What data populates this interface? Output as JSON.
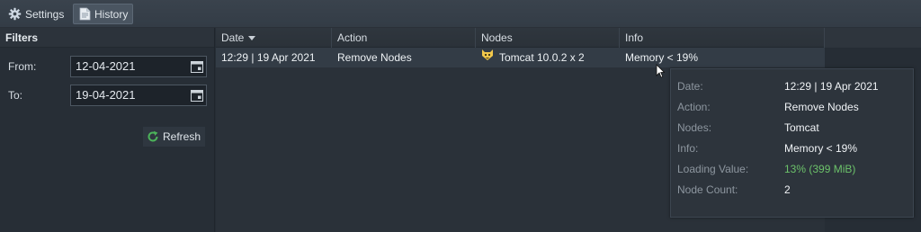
{
  "tabs": {
    "settings_label": "Settings",
    "history_label": "History"
  },
  "filters": {
    "title": "Filters",
    "from_label": "From:",
    "from_value": "12-04-2021",
    "to_label": "To:",
    "to_value": "19-04-2021",
    "refresh_label": "Refresh"
  },
  "table": {
    "columns": [
      "Date",
      "Action",
      "Nodes",
      "Info"
    ],
    "rows": [
      {
        "date": "12:29 | 19 Apr 2021",
        "action": "Remove Nodes",
        "nodes": "Tomcat 10.0.2 x 2",
        "info": "Memory < 19%"
      }
    ]
  },
  "tooltip": {
    "items": [
      {
        "key": "Date:",
        "value": "12:29 | 19 Apr 2021"
      },
      {
        "key": "Action:",
        "value": "Remove Nodes"
      },
      {
        "key": "Nodes:",
        "value": "Tomcat"
      },
      {
        "key": "Info:",
        "value": "Memory < 19%"
      },
      {
        "key": "Loading Value:",
        "value": "13% (399 MiB)"
      },
      {
        "key": "Node Count:",
        "value": "2"
      }
    ]
  },
  "colors": {
    "loading_value": "#6cc26a",
    "refresh_icon": "#4cb35a"
  },
  "icons": {
    "settings": "gear-icon",
    "history": "document-icon",
    "calendar": "calendar-icon",
    "refresh": "refresh-icon",
    "node": "tomcat-icon",
    "sort": "sort-down-icon"
  }
}
